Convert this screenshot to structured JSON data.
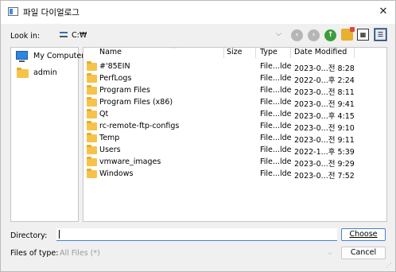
{
  "window": {
    "title": "파일 다이얼로그",
    "close_glyph": "✕"
  },
  "toolbar": {
    "lookin_label": "Look in:",
    "lookin_value": "C:₩",
    "dropdown_glyph": "⌵",
    "back_glyph": "‹",
    "forward_glyph": "›",
    "up_glyph": "↑",
    "list_view_glyph": "▦",
    "detail_view_glyph": "☰"
  },
  "sidebar": {
    "items": [
      {
        "label": "My Computer",
        "icon": "computer-icon"
      },
      {
        "label": "admin",
        "icon": "folder-icon"
      }
    ]
  },
  "filelist": {
    "columns": [
      "Name",
      "Size",
      "Type",
      "Date Modified"
    ],
    "sort_glyph": "^",
    "rows": [
      {
        "name": "#'85EIN",
        "size": "",
        "type": "File...lder",
        "date": "2023-0...전 8:28"
      },
      {
        "name": "PerfLogs",
        "size": "",
        "type": "File...lder",
        "date": "2022-0...후 2:24"
      },
      {
        "name": "Program Files",
        "size": "",
        "type": "File...lder",
        "date": "2023-0...전 8:11"
      },
      {
        "name": "Program Files (x86)",
        "size": "",
        "type": "File...lder",
        "date": "2023-0...전 9:41"
      },
      {
        "name": "Qt",
        "size": "",
        "type": "File...lder",
        "date": "2023-0...후 4:15"
      },
      {
        "name": "rc-remote-ftp-configs",
        "size": "",
        "type": "File...lder",
        "date": "2023-0...전 9:10"
      },
      {
        "name": "Temp",
        "size": "",
        "type": "File...lder",
        "date": "2023-0...전 9:11"
      },
      {
        "name": "Users",
        "size": "",
        "type": "File...lder",
        "date": "2022-1...후 5:39"
      },
      {
        "name": "vmware_images",
        "size": "",
        "type": "File...lder",
        "date": "2023-0...전 9:29"
      },
      {
        "name": "Windows",
        "size": "",
        "type": "File...lder",
        "date": "2023-0...전 7:52"
      }
    ]
  },
  "footer": {
    "directory_label": "Directory:",
    "directory_value": "",
    "choose_label": "Choose",
    "type_label": "Files of type:",
    "type_value": "All Files (*)",
    "cancel_label": "Cancel"
  },
  "colors": {
    "accent": "#4a7fd0",
    "folder": "#f6c34a",
    "up_arrow": "#3c9d3c"
  }
}
